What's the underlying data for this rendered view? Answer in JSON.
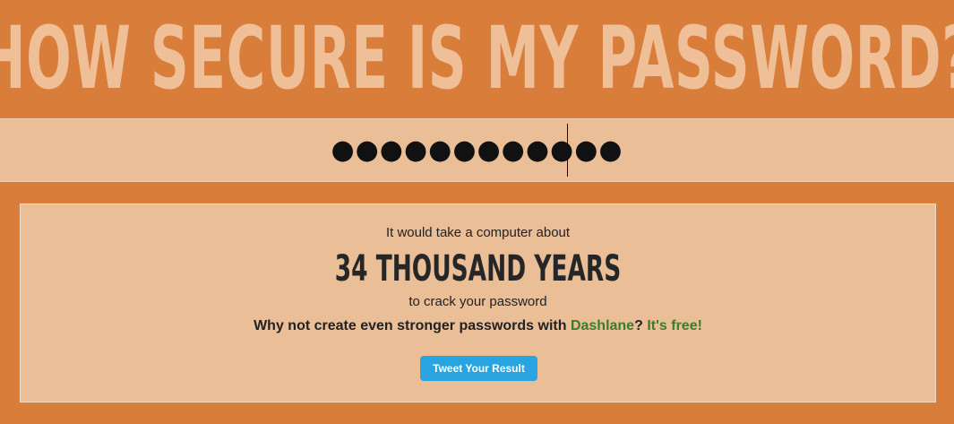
{
  "header": {
    "title": "HOW SECURE IS MY PASSWORD?"
  },
  "password": {
    "masked_value": "●●●●●●●●●●●●"
  },
  "result": {
    "intro": "It would take a computer about",
    "time": "34 THOUSAND YEARS",
    "suffix": "to crack your password",
    "promo_text": "Why not create even stronger passwords with ",
    "brand_link": "Dashlane",
    "question_mark": "?",
    "free_link": "It's free!",
    "tweet_button": "Tweet Your Result"
  },
  "colors": {
    "background": "#d97d3b",
    "panel": "#eabe97",
    "title": "#efbf98",
    "link": "#3a7d2c",
    "tweet": "#2aa3e1"
  }
}
